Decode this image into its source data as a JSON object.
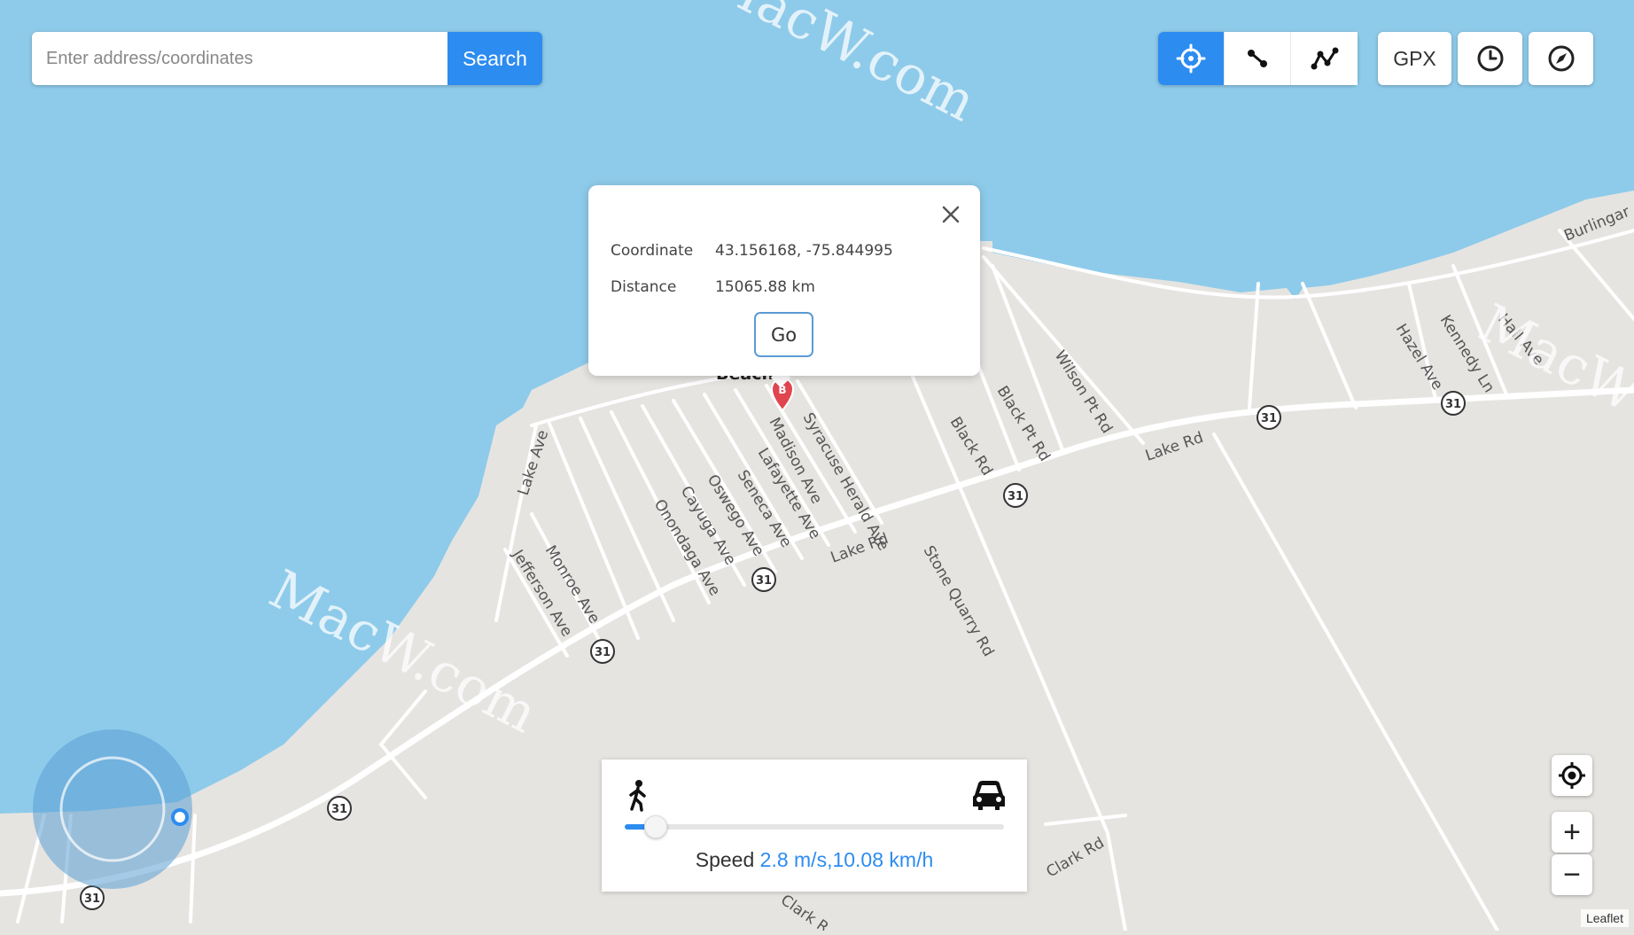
{
  "search": {
    "placeholder": "Enter address/coordinates",
    "button_label": "Search"
  },
  "toolbar": {
    "modes": [
      {
        "name": "teleport",
        "icon": "crosshair-icon",
        "active": true
      },
      {
        "name": "two-spot",
        "icon": "two-spot-route-icon",
        "active": false
      },
      {
        "name": "multi-spot",
        "icon": "multi-spot-route-icon",
        "active": false
      }
    ],
    "gpx_label": "GPX",
    "history_icon": "clock-icon",
    "compass_icon": "compass-icon"
  },
  "popup": {
    "coordinate_label": "Coordinate",
    "coordinate_value": "43.156168, -75.844995",
    "distance_label": "Distance",
    "distance_value": "15065.88 km",
    "go_label": "Go",
    "marker_letter": "B"
  },
  "map_labels": {
    "place_partial": "Beach  ...est",
    "roads": [
      "Lake Rd",
      "Lake Rd",
      "Lake Rd",
      "Lake Ave",
      "Madison Ave",
      "Syracuse Herald Ave",
      "Lafayette Ave",
      "Seneca Ave",
      "Oswego Ave",
      "Cayuga Ave",
      "Onondaga Ave",
      "Monroe Ave",
      "Jefferson Ave",
      "Stone Quarry Rd",
      "Black Pt Rd",
      "Black Rd",
      "Wilson Pt Rd",
      "Hazel Ave",
      "Kennedy Ln",
      "Hall Ave",
      "Burlingar",
      "Clark Rd",
      "Clark R"
    ],
    "route_shield": "31"
  },
  "watermarks": [
    "MacW.com",
    "MacW.com",
    "MacW"
  ],
  "speed": {
    "label": "Speed",
    "value_text": "2.8 m/s,10.08 km/h",
    "walk_icon": "walking-person-icon",
    "car_icon": "car-icon",
    "slider_fraction": 0.08
  },
  "map_controls": {
    "locate_icon": "locate-icon",
    "zoom_in": "+",
    "zoom_out": "−"
  },
  "attribution": "Leaflet",
  "colors": {
    "water": "#8ecbea",
    "land": "#e6e4e1",
    "accent": "#2d8cf0",
    "marker": "#e0444f"
  }
}
